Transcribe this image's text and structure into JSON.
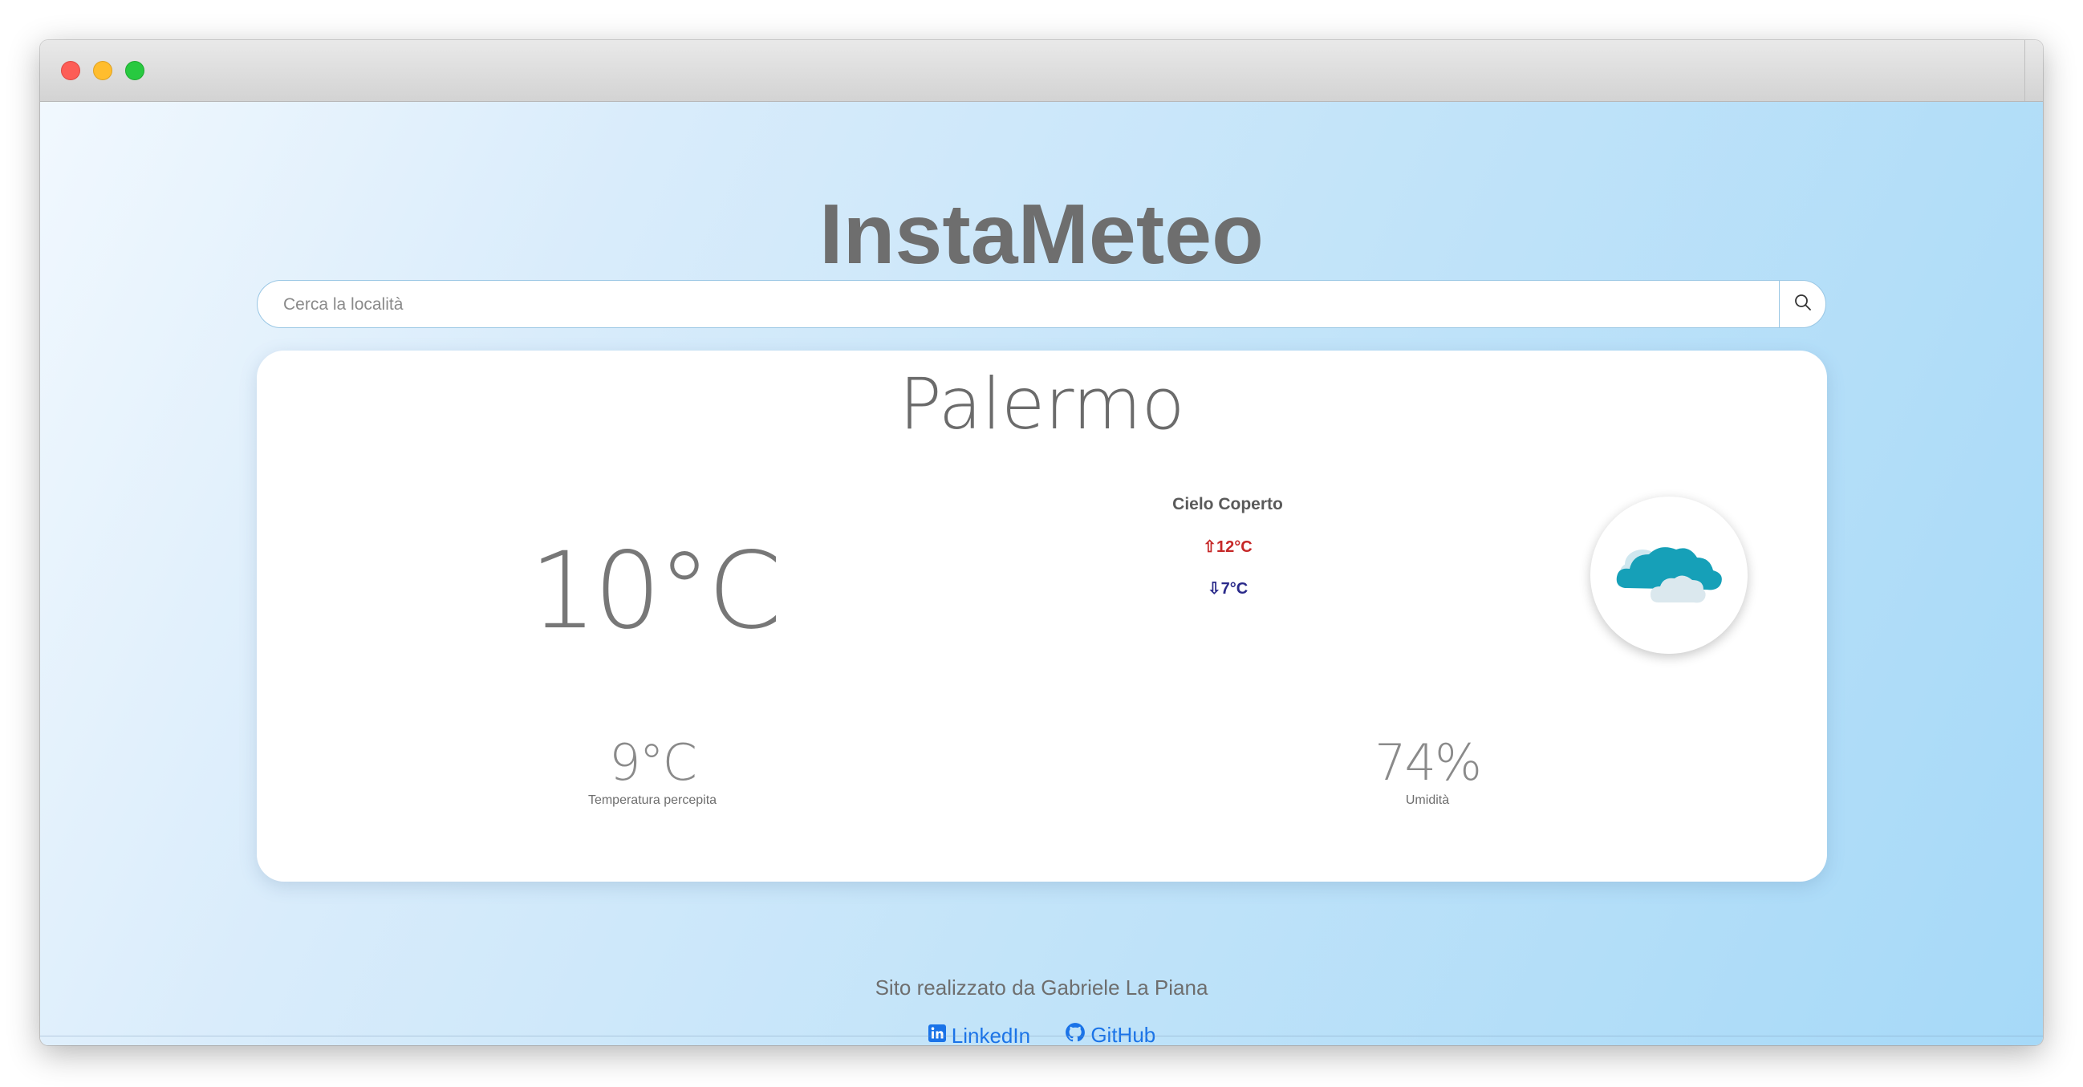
{
  "app": {
    "title": "InstaMeteo"
  },
  "search": {
    "placeholder": "Cerca la località",
    "value": ""
  },
  "weather": {
    "city": "Palermo",
    "temperature": "10°C",
    "condition": "Cielo Coperto",
    "temp_max": "⇧12°C",
    "temp_min": "⇩7°C",
    "icon": "cloudy-icon",
    "feels_like": {
      "value": "9°C",
      "label": "Temperatura percepita"
    },
    "humidity": {
      "value": "74%",
      "label": "Umidità"
    }
  },
  "footer": {
    "credit": "Sito realizzato da Gabriele La Piana",
    "links": [
      {
        "label": "LinkedIn",
        "icon": "linkedin-icon"
      },
      {
        "label": "GitHub",
        "icon": "github-icon"
      }
    ]
  },
  "colors": {
    "max_temp": "#c62828",
    "min_temp": "#2a2a8a",
    "link": "#1a73e8",
    "title": "#6e6e6e"
  }
}
